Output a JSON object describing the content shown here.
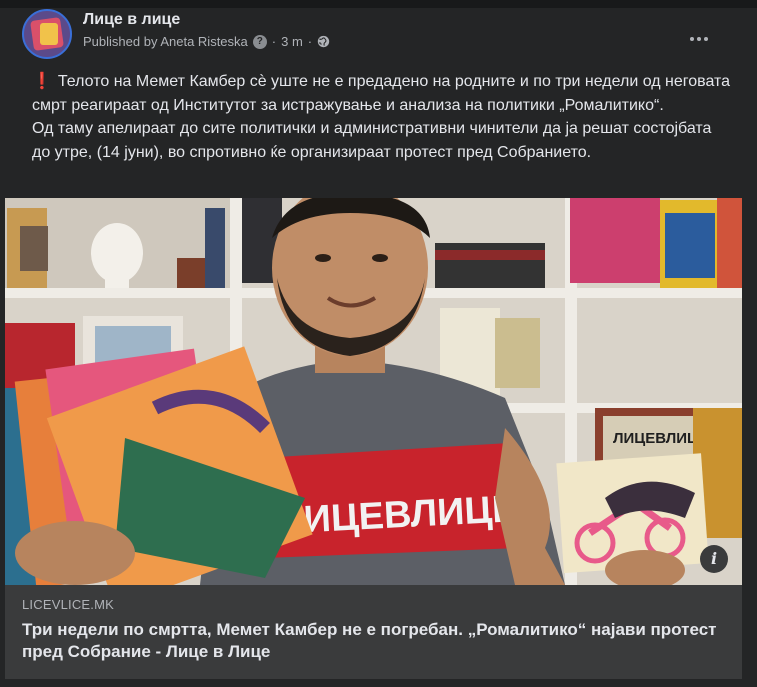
{
  "post": {
    "page_name": "Лице в лице",
    "published_by": "Published by Aneta Risteska",
    "help_symbol": "?",
    "separator": "·",
    "time": "3 m",
    "separator2": "·",
    "body_line1": "Телото на Мемет Камбер сѐ уште не е предадено на родните и по три недели од неговата смрт реагираат од Институтот за истражување и анализа на политики „Ромалитико“.",
    "body_line2": "Од таму апелираат до сите политички и административни чинители да ја решат состојбата до утре, (14 јуни), во спротивно ќе организираат протест пред Собранието.",
    "exclamation": "❗"
  },
  "image": {
    "shirt_text": "ЛИЦЕВЛИЦЕ",
    "poster_text": "ЛИЦЕВЛИЦЕ",
    "info_label": "i"
  },
  "link": {
    "domain": "LICEVLICE.MK",
    "title": "Три недели по смртта, Мемет Камбер не е погребан. „Ромалитико“ најави протест пред Собрание - Лице в Лице"
  },
  "colors": {
    "background": "#18191a",
    "card": "#242526",
    "link_box": "#3a3b3c",
    "text_primary": "#e4e6eb",
    "text_secondary": "#b0b3b8",
    "shirt_red": "#c8232c"
  }
}
